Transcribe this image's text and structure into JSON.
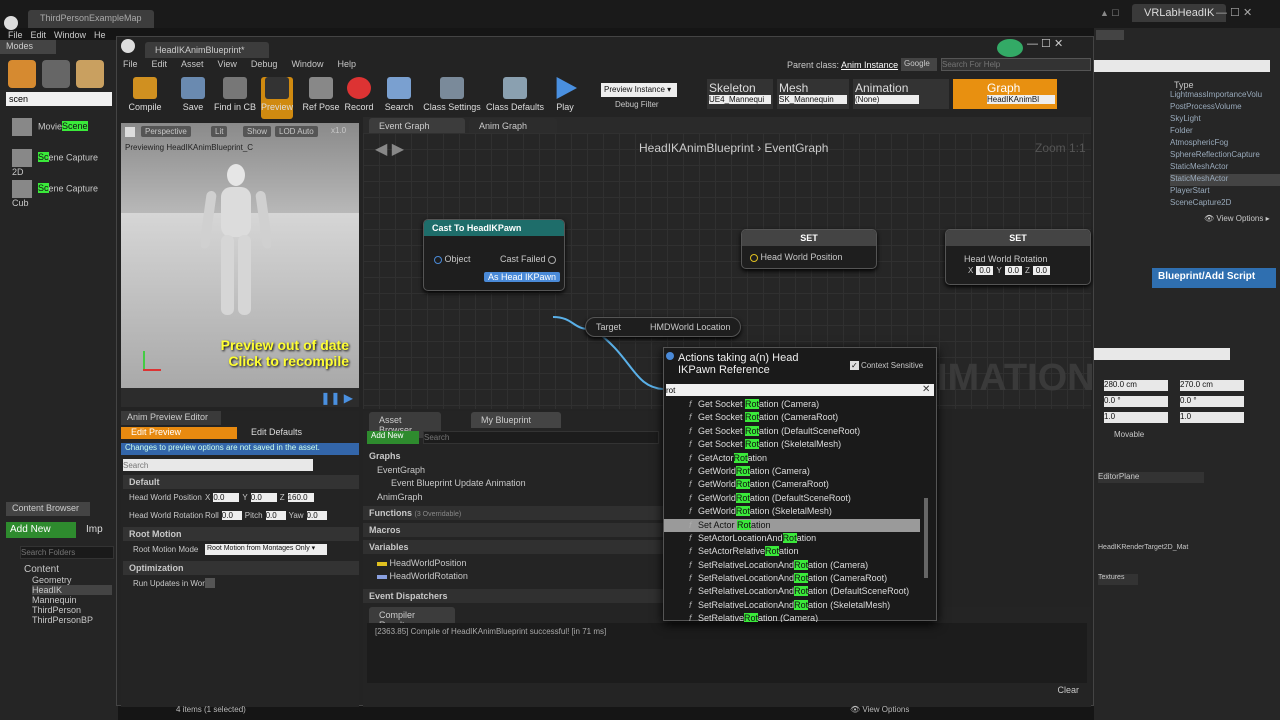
{
  "outer": {
    "tab_map": "ThirdPersonExampleMap",
    "tab_right": "VRLabHeadIK",
    "menu": [
      "File",
      "Edit",
      "Window",
      "He"
    ],
    "modes_title": "Modes",
    "search_value": "scen",
    "items": [
      {
        "pre": "Movie",
        "hl": "Scene",
        "post": ""
      },
      {
        "pre": "",
        "hl": "Sc",
        "post": "ene Capture 2D"
      },
      {
        "pre": "",
        "hl": "Sc",
        "post": "ene Capture Cub"
      }
    ]
  },
  "content_browser": {
    "tab": "Content Browser",
    "add_new": "Add New",
    "import": "Imp",
    "search_placeholder": "Search Folders",
    "tree": [
      "Content",
      "Geometry",
      "HeadIK",
      "Mannequin",
      "ThirdPerson",
      "ThirdPersonBP"
    ]
  },
  "bp": {
    "tab": "HeadIKAnimBlueprint*",
    "menu": [
      "File",
      "Edit",
      "Asset",
      "View",
      "Debug",
      "Window",
      "Help"
    ],
    "parent_label": "Parent class:",
    "parent_value": "Anim Instance",
    "google": "Google",
    "search_help": "Search For Help",
    "toolbar": [
      "Compile",
      "Save",
      "Find in CB",
      "Preview",
      "Ref Pose",
      "Record",
      "Search",
      "Class Settings",
      "Class Defaults",
      "Play"
    ],
    "preview_instance": "Preview Instance",
    "debug_filter": "Debug Filter",
    "modes": [
      {
        "t": "Skeleton",
        "v": "UE4_Mannequi"
      },
      {
        "t": "Mesh",
        "v": "SK_Mannequin"
      },
      {
        "t": "Animation",
        "v": "(None)"
      },
      {
        "t": "Graph",
        "v": "HeadIKAnimBl"
      }
    ]
  },
  "viewport": {
    "perspective": "Perspective",
    "lit": "Lit",
    "show": "Show",
    "lod": "LOD Auto",
    "speed": "x1.0",
    "previewing": "Previewing HeadIKAnimBlueprint_C",
    "warn1": "Preview out of date",
    "warn2": "Click to recompile"
  },
  "graph": {
    "tabs": [
      "Event Graph",
      "Anim Graph"
    ],
    "breadcrumb": "HeadIKAnimBlueprint",
    "crumb2": "EventGraph",
    "zoom": "Zoom 1:1",
    "watermark": "IMATION",
    "cast_title": "Cast To HeadIKPawn",
    "object": "Object",
    "cast_failed": "Cast Failed",
    "as_pawn": "As Head IKPawn",
    "target": "Target",
    "hmd": "HMDWorld Location",
    "set": "SET",
    "head_pos": "Head World Position",
    "head_rot": "Head World Rotation",
    "rot_vals": [
      "X",
      "0.0",
      "Y",
      "0.0",
      "Z",
      "0.0"
    ]
  },
  "actions": {
    "title": "Actions taking a(n) Head IKPawn Reference",
    "context": "Context Sensitive",
    "search": "rot",
    "items": [
      [
        "Get Socket ",
        "Rot",
        "ation (Camera)"
      ],
      [
        "Get Socket ",
        "Rot",
        "ation (CameraRoot)"
      ],
      [
        "Get Socket ",
        "Rot",
        "ation (DefaultSceneRoot)"
      ],
      [
        "Get Socket ",
        "Rot",
        "ation (SkeletalMesh)"
      ],
      [
        "GetActor",
        "Rot",
        "ation"
      ],
      [
        "GetWorld",
        "Rot",
        "ation (Camera)"
      ],
      [
        "GetWorld",
        "Rot",
        "ation (CameraRoot)"
      ],
      [
        "GetWorld",
        "Rot",
        "ation (DefaultSceneRoot)"
      ],
      [
        "GetWorld",
        "Rot",
        "ation (SkeletalMesh)"
      ],
      [
        "Set Actor ",
        "Rot",
        "ation"
      ],
      [
        "SetActorLocationAnd",
        "Rot",
        "ation"
      ],
      [
        "SetActorRelative",
        "Rot",
        "ation"
      ],
      [
        "SetRelativeLocationAnd",
        "Rot",
        "ation (Camera)"
      ],
      [
        "SetRelativeLocationAnd",
        "Rot",
        "ation (CameraRoot)"
      ],
      [
        "SetRelativeLocationAnd",
        "Rot",
        "ation (DefaultSceneRoot)"
      ],
      [
        "SetRelativeLocationAnd",
        "Rot",
        "ation (SkeletalMesh)"
      ],
      [
        "SetRelative",
        "Rot",
        "ation (Camera)"
      ]
    ],
    "selected": 9
  },
  "preview_editor": {
    "tab": "Anim Preview Editor",
    "edit_preview": "Edit Preview",
    "edit_defaults": "Edit Defaults",
    "notice": "Changes to preview options are not saved in the asset.",
    "search": "Search",
    "default": "Default",
    "hwp": "Head World Position",
    "hwp_vals": [
      "X",
      "0.0",
      "Y",
      "0.0",
      "Z",
      "160.0"
    ],
    "hwr": "Head World Rotation",
    "hwr_vals": [
      "Roll",
      "0.0",
      "Pitch",
      "0.0",
      "Yaw",
      "0.0"
    ],
    "root_motion": "Root Motion",
    "rmm": "Root Motion Mode",
    "rmm_val": "Root Motion from Montages Only",
    "optimization": "Optimization",
    "run_updates": "Run Updates in Worl"
  },
  "my_bp": {
    "tabs": [
      "Asset Browser",
      "My Blueprint"
    ],
    "add_new": "Add New",
    "search": "Search",
    "graphs": "Graphs",
    "event_graph": "EventGraph",
    "bua": "Event Blueprint Update Animation",
    "anim_graph": "AnimGraph",
    "functions": "Functions",
    "overridable": "(3 Overridable)",
    "macros": "Macros",
    "variables": "Variables",
    "vars": [
      "HeadWorldPosition",
      "HeadWorldRotation"
    ],
    "dispatchers": "Event Dispatchers"
  },
  "compiler": {
    "tab": "Compiler Results",
    "message": "[2363.85] Compile of HeadIKAnimBlueprint successful! [in 71 ms]",
    "clear": "Clear"
  },
  "status": {
    "items": "4 items (1 selected)",
    "view_options": "View Options"
  },
  "right": {
    "type": "Type",
    "list": [
      "LightmassImportanceVolu",
      "PostProcessVolume",
      "SkyLight",
      "Folder",
      "AtmosphericFog",
      "SphereReflectionCapture",
      "StaticMeshActor",
      "StaticMeshActor",
      "PlayerStart",
      "SceneCapture2D"
    ],
    "view_options": "View Options",
    "bp_script": "Blueprint/Add Script",
    "v1": "280.0 cm",
    "v2": "270.0 cm",
    "v3": "0.0 °",
    "v4": "0.0 °",
    "v5": "1.0",
    "v6": "1.0",
    "movable": "Movable",
    "editor_plane": "EditorPlane",
    "rt": "HeadIKRenderTarget2D_Mat",
    "textures": "Textures"
  }
}
